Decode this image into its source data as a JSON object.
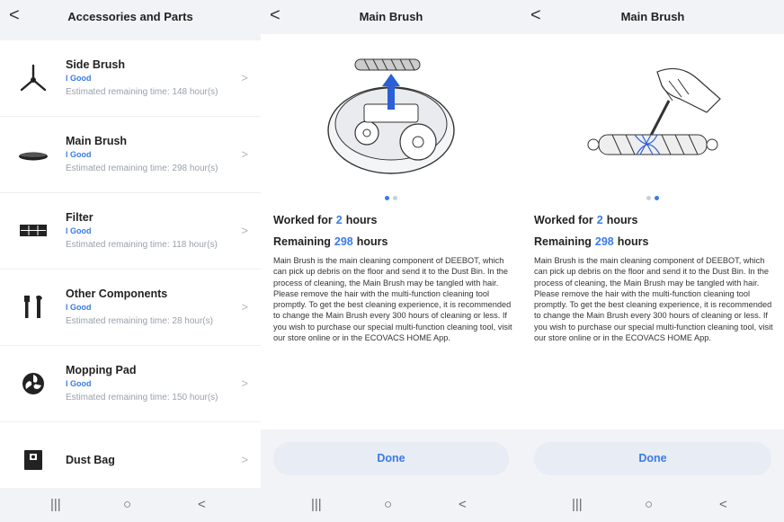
{
  "list_screen": {
    "title": "Accessories and Parts",
    "back_glyph": "<",
    "items": [
      {
        "name": "Side Brush",
        "status": "l Good",
        "estimate": "Estimated remaining time: 148 hour(s)",
        "icon": "side-brush-icon"
      },
      {
        "name": "Main Brush",
        "status": "l Good",
        "estimate": "Estimated remaining time: 298 hour(s)",
        "icon": "main-brush-icon"
      },
      {
        "name": "Filter",
        "status": "l Good",
        "estimate": "Estimated remaining time: 118 hour(s)",
        "icon": "filter-icon"
      },
      {
        "name": "Other Components",
        "status": "l Good",
        "estimate": "Estimated remaining time: 28 hour(s)",
        "icon": "tools-icon"
      },
      {
        "name": "Mopping Pad",
        "status": "l Good",
        "estimate": "Estimated remaining time: 150 hour(s)",
        "icon": "mopping-pad-icon"
      },
      {
        "name": "Dust Bag",
        "icon": "dust-bag-icon"
      }
    ],
    "chevron": ">"
  },
  "detail_screens": [
    {
      "title": "Main Brush",
      "back_glyph": "<",
      "worked_label": "Worked for",
      "worked_value": "2",
      "worked_unit": "hours",
      "remaining_label": "Remaining",
      "remaining_value": "298",
      "remaining_unit": "hours",
      "description": "Main Brush is the main cleaning component of DEEBOT, which can pick up debris on the floor and send it to the Dust Bin. In the process of cleaning, the Main Brush may be tangled with hair. Please remove the hair with the multi-function cleaning tool promptly. To get the best cleaning experience, it is recommended to change the Main Brush every 300 hours of cleaning or less. If you wish to purchase our special multi-function cleaning tool, visit our store online or in the ECOVACS HOME App.",
      "done_label": "Done",
      "active_page": 1
    },
    {
      "title": "Main Brush",
      "back_glyph": "<",
      "worked_label": "Worked for",
      "worked_value": "2",
      "worked_unit": "hours",
      "remaining_label": "Remaining",
      "remaining_value": "298",
      "remaining_unit": "hours",
      "description": "Main Brush is the main cleaning component of DEEBOT, which can pick up debris on the floor and send it to the Dust Bin. In the process of cleaning, the Main Brush may be tangled with hair. Please remove the hair with the multi-function cleaning tool promptly. To get the best cleaning experience, it is recommended to change the Main Brush every 300 hours of cleaning or less. If you wish to purchase our special multi-function cleaning tool, visit our store online or in the ECOVACS HOME App.",
      "done_label": "Done",
      "active_page": 2
    }
  ],
  "navbar": {
    "recents": "|||",
    "home": "○",
    "back": "<"
  },
  "colors": {
    "accent": "#3a7be8",
    "background": "#f2f3f7"
  }
}
